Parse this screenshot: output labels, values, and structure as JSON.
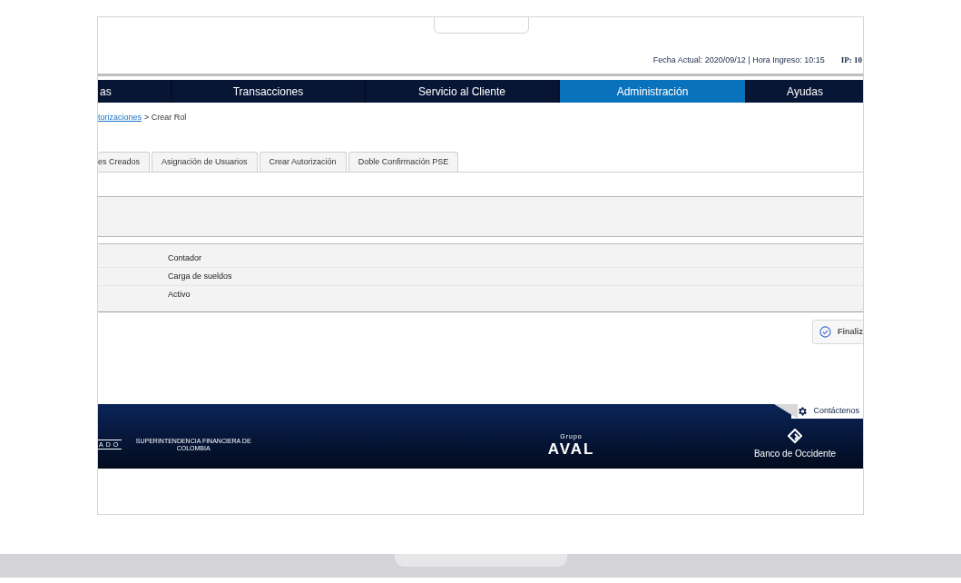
{
  "header": {
    "info": "Fecha Actual: 2020/09/12 | Hora Ingreso: 10:15",
    "ip": "IP: 10"
  },
  "nav": [
    {
      "label": "as",
      "selected": false
    },
    {
      "label": "Transacciones",
      "selected": false
    },
    {
      "label": "Servicio al Cliente",
      "selected": false
    },
    {
      "label": "Administración",
      "selected": true
    },
    {
      "label": "Ayudas",
      "selected": false
    }
  ],
  "breadcrumb": {
    "link": "torizaciones",
    "current": "> Crear Rol"
  },
  "tabs": [
    {
      "label": "es Creados",
      "selected": false
    },
    {
      "label": "Asignación de Usuarios",
      "selected": false
    },
    {
      "label": "Crear Autorización",
      "selected": false
    },
    {
      "label": "Doble Confirmación PSE",
      "selected": false
    }
  ],
  "rows": [
    "Contador",
    "Carga de sueldos",
    "Activo"
  ],
  "finish_button": "Finaliz",
  "footer": {
    "contact": "Contáctenos",
    "left_mark": "ADO",
    "left_text": "SUPERINTENDENCIA FINANCIERA DE COLOMBIA",
    "center_small": "Grupo",
    "center_logo": "AVAL",
    "right_text": "Banco de Occidente"
  }
}
